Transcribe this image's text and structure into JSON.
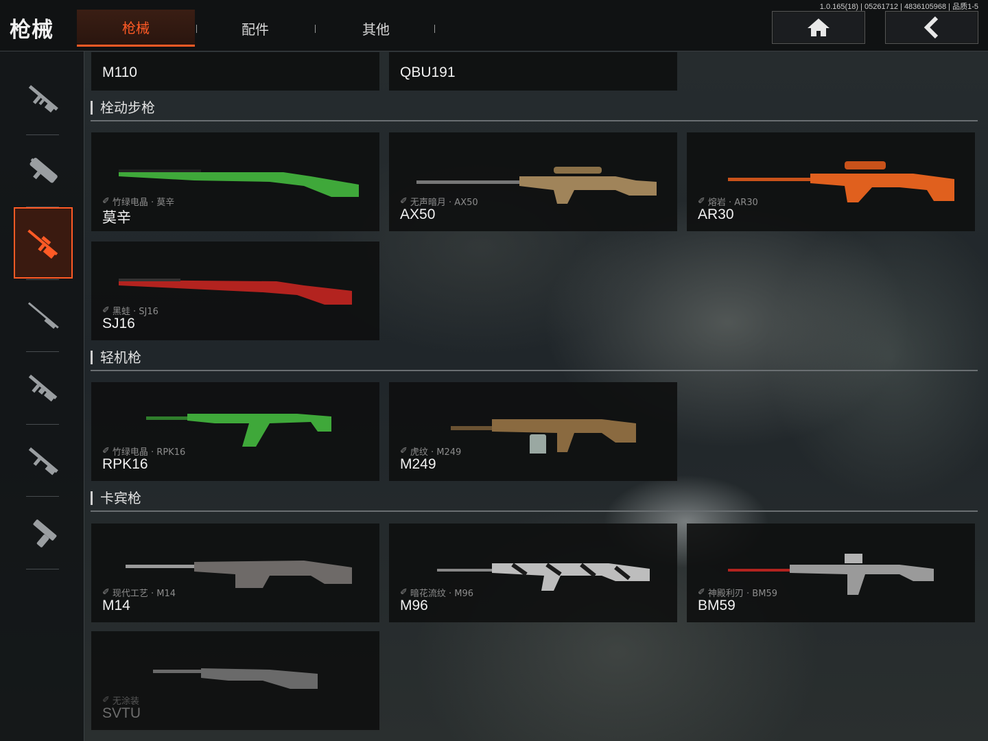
{
  "app": {
    "title": "枪械",
    "version": "1.0.165(18) | 05261712 | 4836105968 | 品质1-5"
  },
  "tabs": [
    {
      "label": "枪械",
      "active": true
    },
    {
      "label": "配件",
      "active": false
    },
    {
      "label": "其他",
      "active": false
    }
  ],
  "header_buttons": {
    "home": "home-icon",
    "back": "chevron-left-icon"
  },
  "sidebar": {
    "items": [
      {
        "icon": "assault-rifle-icon",
        "active": false
      },
      {
        "icon": "smg-icon",
        "active": false
      },
      {
        "icon": "sniper-rifle-icon",
        "active": true
      },
      {
        "icon": "marksman-rifle-icon",
        "active": false
      },
      {
        "icon": "lmg-icon",
        "active": false
      },
      {
        "icon": "shotgun-icon",
        "active": false
      },
      {
        "icon": "pistol-icon",
        "active": false
      }
    ]
  },
  "top_partial_items": [
    {
      "name": "M110"
    },
    {
      "name": "QBU191"
    }
  ],
  "sections": [
    {
      "title": "栓动步枪",
      "items": [
        {
          "skin": "竹绿电晶 · 莫辛",
          "name": "莫辛",
          "color": "#3fa83a"
        },
        {
          "skin": "无声暗月 · AX50",
          "name": "AX50",
          "color": "#a0845a"
        },
        {
          "skin": "熔岩 · AR30",
          "name": "AR30",
          "color": "#e0601e"
        },
        {
          "skin": "黑蛙 · SJ16",
          "name": "SJ16",
          "color": "#b3231f"
        }
      ]
    },
    {
      "title": "轻机枪",
      "items": [
        {
          "skin": "竹绿电晶 · RPK16",
          "name": "RPK16",
          "color": "#3fa83a"
        },
        {
          "skin": "虎纹 · M249",
          "name": "M249",
          "color": "#8a6a40"
        }
      ]
    },
    {
      "title": "卡宾枪",
      "items": [
        {
          "skin": "现代工艺 · M14",
          "name": "M14",
          "color": "#6e6a68"
        },
        {
          "skin": "暗花流纹 · M96",
          "name": "M96",
          "color": "#bdbdbd"
        },
        {
          "skin": "神殿利刃 · BM59",
          "name": "BM59",
          "color": "#9a9a9a"
        },
        {
          "skin": "无涂装",
          "name": "SVTU",
          "color": "#6a6a6a",
          "dim": true
        }
      ]
    }
  ]
}
